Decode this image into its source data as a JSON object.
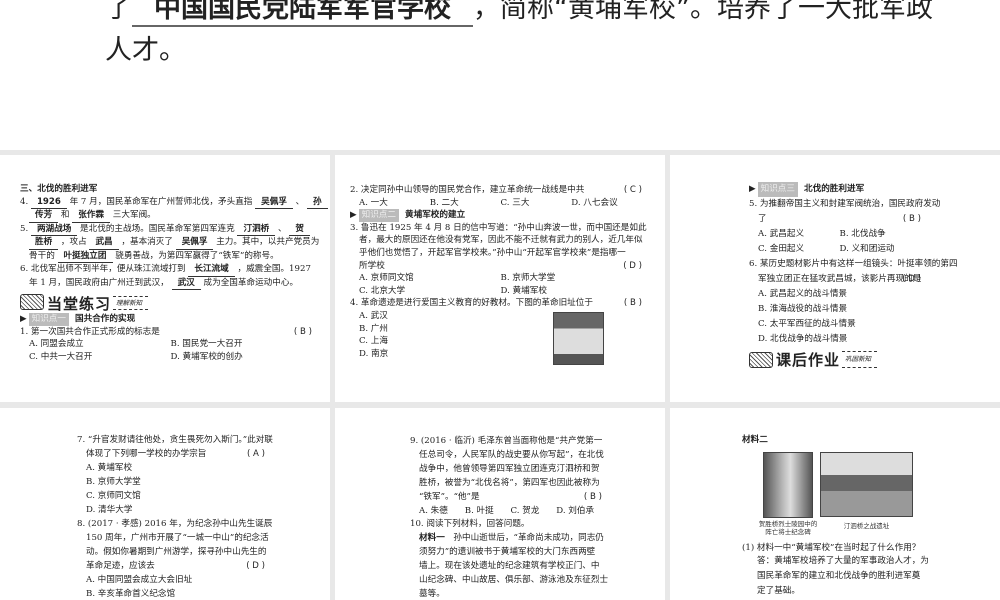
{
  "top": {
    "pre": "了",
    "blank": "中国国民党陆军军官学校",
    "post": "，简称“黄埔军校”。培养了一大批军政",
    "line2": "人才。"
  },
  "panels": [
    {
      "items": [
        {
          "k": "text",
          "bold": true,
          "s": [
            {
              "t": "三、北伐的胜利进军"
            }
          ]
        },
        {
          "k": "text",
          "s": [
            {
              "t": "4. "
            },
            {
              "b": "1926"
            },
            {
              "t": " 年 7 月，国民革命军在广州誓师北伐，矛头直指 "
            },
            {
              "b": "吴佩孚"
            },
            {
              "t": " 、 "
            },
            {
              "b": "孙"
            }
          ]
        },
        {
          "k": "text",
          "ind": true,
          "s": [
            {
              "b": "传芳"
            },
            {
              "t": " 和 "
            },
            {
              "b": "张作霖"
            },
            {
              "t": " 三大军阀。"
            }
          ]
        },
        {
          "k": "text",
          "s": [
            {
              "t": "5. "
            },
            {
              "b": "两湖战场"
            },
            {
              "t": " 是北伐的主战场。国民革命军第四军连克 "
            },
            {
              "b": "汀泗桥"
            },
            {
              "t": " 、 "
            },
            {
              "b": "贺"
            }
          ]
        },
        {
          "k": "text",
          "ind": true,
          "s": [
            {
              "b": "胜桥"
            },
            {
              "t": " ，攻占 "
            },
            {
              "b": "武昌"
            },
            {
              "t": " ，基本消灭了 "
            },
            {
              "b": "吴佩孚"
            },
            {
              "t": " 主力。其中，以共产党员为"
            }
          ]
        },
        {
          "k": "text",
          "ind": true,
          "s": [
            {
              "t": "骨干的 "
            },
            {
              "b": "叶挺独立团"
            },
            {
              "t": " 骁勇善战，为第四军赢得了“铁军”的称号。"
            }
          ]
        },
        {
          "k": "text",
          "s": [
            {
              "t": "6. 北伐军出师不到半年，便从珠江流域打到 "
            },
            {
              "b": "长江流域"
            },
            {
              "t": " ，威震全国。1927"
            }
          ]
        },
        {
          "k": "text",
          "ind": true,
          "s": [
            {
              "t": "年 1 月，国民政府由广州迁到武汉， "
            },
            {
              "b": "武汉"
            },
            {
              "t": " 成为全国革命运动中心。"
            }
          ]
        },
        {
          "k": "banner",
          "big": "当堂练习",
          "small": "理解新知",
          "icon": "pen-notebook-icon"
        },
        {
          "k": "kp",
          "tag": "知识点一",
          "title": "国共合作的实现"
        },
        {
          "k": "text",
          "s": [
            {
              "t": "1. 第一次国共合作正式形成的标志是"
            }
          ],
          "ans": "( B )"
        },
        {
          "k": "opts",
          "o": [
            "A. 同盟会成立",
            "B. 国民党一大召开"
          ]
        },
        {
          "k": "opts",
          "o": [
            "C. 中共一大召开",
            "D. 黄埔军校的创办"
          ]
        }
      ]
    },
    {
      "items": [
        {
          "k": "text",
          "s": [
            {
              "t": "2. 决定同孙中山领导的国民党合作，建立革命统一战线是中共"
            }
          ],
          "ans": "( C )"
        },
        {
          "k": "opts",
          "o": [
            "A. 一大",
            "B. 二大",
            "C. 三大",
            "D. 八七会议"
          ]
        },
        {
          "k": "kp",
          "tag": "知识点二",
          "title": "黄埔军校的建立"
        },
        {
          "k": "text",
          "s": [
            {
              "t": "3. 鲁迅在 1925 年 4 月 8 日的信中写道：“孙中山奔波一世，而中国还是如此"
            }
          ]
        },
        {
          "k": "text",
          "ind": true,
          "s": [
            {
              "t": "者，最大的原因还在他没有党军，因此不能不迁就有武力的别人，近几年似"
            }
          ]
        },
        {
          "k": "text",
          "ind": true,
          "s": [
            {
              "t": "乎他们也觉悟了，开起军官学校来。”孙中山“开起军官学校来”是指哪一"
            }
          ]
        },
        {
          "k": "text",
          "ind": true,
          "s": [
            {
              "t": "所学校"
            }
          ],
          "ans": "( D )"
        },
        {
          "k": "opts",
          "o": [
            "A. 京师同文馆",
            "B. 京师大学堂"
          ]
        },
        {
          "k": "opts",
          "o": [
            "C. 北京大学",
            "D. 黄埔军校"
          ]
        },
        {
          "k": "text",
          "s": [
            {
              "t": "4. 革命遗迹是进行爱国主义教育的好教材。下图的革命旧址位于"
            }
          ],
          "ans": "( B )"
        },
        {
          "k": "text",
          "ind": true,
          "s": [
            {
              "t": "A. 武汉"
            }
          ]
        },
        {
          "k": "text",
          "ind": true,
          "s": [
            {
              "t": "B. 广州"
            }
          ]
        },
        {
          "k": "text",
          "ind": true,
          "s": [
            {
              "t": "C. 上海"
            }
          ]
        },
        {
          "k": "text",
          "ind": true,
          "s": [
            {
              "t": "D. 南京"
            }
          ]
        }
      ]
    },
    {
      "items": [
        {
          "k": "kp",
          "tag": "知识点三",
          "title": "北伐的胜利进军"
        },
        {
          "k": "text",
          "s": [
            {
              "t": "5. 为推翻帝国主义和封建军阀统治，国民政府发动"
            }
          ]
        },
        {
          "k": "text",
          "ind": true,
          "s": [
            {
              "t": "了"
            }
          ],
          "ans": "( B )"
        },
        {
          "k": "opts",
          "o": [
            "A. 武昌起义",
            "B. 北伐战争"
          ]
        },
        {
          "k": "opts",
          "o": [
            "C. 金田起义",
            "D. 义和团运动"
          ]
        },
        {
          "k": "text",
          "s": [
            {
              "t": "6. 某历史题材影片中有这样一组镜头：叶挺率领的第四"
            }
          ]
        },
        {
          "k": "text",
          "ind": true,
          "s": [
            {
              "t": "军独立团正在猛攻武昌城，该影片再现的是"
            }
          ],
          "ans": "( D )"
        },
        {
          "k": "text",
          "ind": true,
          "s": [
            {
              "t": "A. 武昌起义的战斗情景"
            }
          ]
        },
        {
          "k": "text",
          "ind": true,
          "s": [
            {
              "t": "B. 淮海战役的战斗情景"
            }
          ]
        },
        {
          "k": "text",
          "ind": true,
          "s": [
            {
              "t": "C. 太平军西征的战斗情景"
            }
          ]
        },
        {
          "k": "text",
          "ind": true,
          "s": [
            {
              "t": "D. 北伐战争的战斗情景"
            }
          ]
        },
        {
          "k": "banner",
          "big": "课后作业",
          "small": "巩固新知",
          "icon": "books-cap-icon"
        }
      ]
    },
    {
      "items": [
        {
          "k": "text",
          "s": [
            {
              "t": "7. “升官发财请往他处，贪生畏死勿入斯门。”此对联"
            }
          ]
        },
        {
          "k": "text",
          "ind": true,
          "s": [
            {
              "t": "体现了下列哪一学校的办学宗旨"
            }
          ],
          "ans": "( A )"
        },
        {
          "k": "text",
          "ind": true,
          "s": [
            {
              "t": "A. 黄埔军校"
            }
          ]
        },
        {
          "k": "text",
          "ind": true,
          "s": [
            {
              "t": "B. 京师大学堂"
            }
          ]
        },
        {
          "k": "text",
          "ind": true,
          "s": [
            {
              "t": "C. 京师同文馆"
            }
          ]
        },
        {
          "k": "text",
          "ind": true,
          "s": [
            {
              "t": "D. 清华大学"
            }
          ]
        },
        {
          "k": "text",
          "s": [
            {
              "t": "8. (2017 · 孝感) 2016 年，为纪念孙中山先生诞辰"
            }
          ]
        },
        {
          "k": "text",
          "ind": true,
          "s": [
            {
              "t": "150 周年，广州市开展了“一城一中山”的纪念活"
            }
          ]
        },
        {
          "k": "text",
          "ind": true,
          "s": [
            {
              "t": "动。假如你暑期到广州游学，探寻孙中山先生的"
            }
          ]
        },
        {
          "k": "text",
          "ind": true,
          "s": [
            {
              "t": "革命足迹，应该去"
            }
          ],
          "ans": "( D )"
        },
        {
          "k": "text",
          "ind": true,
          "s": [
            {
              "t": "A. 中国同盟会成立大会旧址"
            }
          ]
        },
        {
          "k": "text",
          "ind": true,
          "s": [
            {
              "t": "B. 辛亥革命首义纪念馆"
            }
          ]
        }
      ]
    },
    {
      "items": [
        {
          "k": "text",
          "s": [
            {
              "t": "9. (2016 · 临沂) 毛泽东曾当面称他是“共产党第一"
            }
          ]
        },
        {
          "k": "text",
          "ind": true,
          "s": [
            {
              "t": "任总司令，人民军队的战史要从你写起”，在北伐"
            }
          ]
        },
        {
          "k": "text",
          "ind": true,
          "s": [
            {
              "t": "战争中，他曾领导第四军独立团连克汀泗桥和贺"
            }
          ]
        },
        {
          "k": "text",
          "ind": true,
          "s": [
            {
              "t": "胜桥，被誉为“北伐名将”，第四军也因此被称为"
            }
          ]
        },
        {
          "k": "text",
          "ind": true,
          "s": [
            {
              "t": "“铁军”。“他”是"
            }
          ],
          "ans": "( B )"
        },
        {
          "k": "opts",
          "ind": true,
          "o": [
            "A. 朱德",
            "B. 叶挺",
            "C. 贺龙",
            "D. 刘伯承"
          ]
        },
        {
          "k": "text",
          "s": [
            {
              "t": "10. 阅读下列材料，回答问题。"
            }
          ]
        },
        {
          "k": "text",
          "ind": true,
          "s": [
            {
              "t": "材料一",
              "bold": true
            },
            {
              "t": "　孙中山逝世后，“革命尚未成功，同志仍"
            }
          ]
        },
        {
          "k": "text",
          "ind": true,
          "s": [
            {
              "t": "须努力”的遗训被书于黄埔军校的大门东西两壁"
            }
          ]
        },
        {
          "k": "text",
          "ind": true,
          "s": [
            {
              "t": "墙上。现在该处遗址的纪念建筑有学校正门、中"
            }
          ]
        },
        {
          "k": "text",
          "ind": true,
          "s": [
            {
              "t": "山纪念碑、中山故居、俱乐部、游泳池及东征烈士"
            }
          ]
        },
        {
          "k": "text",
          "ind": true,
          "s": [
            {
              "t": "墓等。"
            }
          ]
        }
      ]
    },
    {
      "items": [
        {
          "k": "text",
          "bold": true,
          "s": [
            {
              "t": "材料二"
            }
          ]
        }
      ],
      "captions": [
        "贺胜桥烈士陵园中的阵亡将士纪念碑",
        "汀泗桥之战遗址"
      ],
      "q": "(1) 材料一中“黄埔军校”在当时起了什么作用？",
      "answer": [
        "答：黄埔军校培养了大量的军事政治人才，为",
        "国民革命军的建立和北伐战争的胜利进军奠",
        "定了基础。"
      ]
    }
  ]
}
